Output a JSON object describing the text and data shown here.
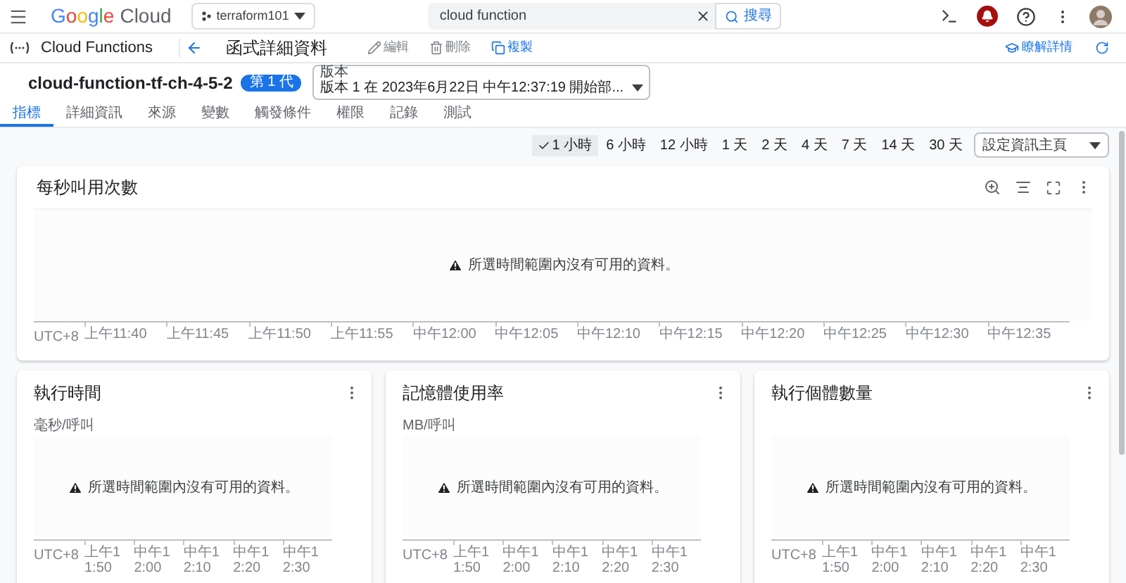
{
  "header": {
    "logo_word": "Google",
    "logo_product": "Cloud",
    "project": "terraform101",
    "search": {
      "value": "cloud function",
      "button": "搜尋"
    }
  },
  "subheader": {
    "product": "Cloud Functions",
    "page_title": "函式詳細資料",
    "actions": [
      {
        "label": "編輯",
        "disabled": true,
        "kind": "edit"
      },
      {
        "label": "刪除",
        "disabled": true,
        "kind": "delete"
      },
      {
        "label": "複製",
        "disabled": false,
        "kind": "copy"
      }
    ],
    "learn_more": "瞭解詳情"
  },
  "function": {
    "name": "cloud-function-tf-ch-4-5-2",
    "badge": "第 1 代",
    "version_label": "版本",
    "version": "版本 1 在 2023年6月22日 中午12:37:19 開始部..."
  },
  "tabs": [
    {
      "label": "指標",
      "selected": true
    },
    {
      "label": "詳細資訊",
      "selected": false
    },
    {
      "label": "來源",
      "selected": false
    },
    {
      "label": "變數",
      "selected": false
    },
    {
      "label": "觸發條件",
      "selected": false
    },
    {
      "label": "權限",
      "selected": false
    },
    {
      "label": "記錄",
      "selected": false
    },
    {
      "label": "測試",
      "selected": false
    }
  ],
  "time_ranges": [
    {
      "label": "1 小時",
      "selected": true
    },
    {
      "label": "6 小時",
      "selected": false
    },
    {
      "label": "12 小時",
      "selected": false
    },
    {
      "label": "1 天",
      "selected": false
    },
    {
      "label": "2 天",
      "selected": false
    },
    {
      "label": "4 天",
      "selected": false
    },
    {
      "label": "7 天",
      "selected": false
    },
    {
      "label": "14 天",
      "selected": false
    },
    {
      "label": "30 天",
      "selected": false
    }
  ],
  "dashboard_select": "設定資訊主頁",
  "main_chart": {
    "title": "每秒叫用次數",
    "message": "所選時間範圍內沒有可用的資料。",
    "timezone": "UTC+8",
    "ticks": [
      "上午11:40",
      "上午11:45",
      "上午11:50",
      "上午11:55",
      "中午12:00",
      "中午12:05",
      "中午12:10",
      "中午12:15",
      "中午12:20",
      "中午12:25",
      "中午12:30",
      "中午12:35"
    ]
  },
  "small_charts": [
    {
      "title": "執行時間",
      "subtitle": "毫秒/呼叫",
      "message": "所選時間範圍內沒有可用的資料。",
      "timezone": "UTC+8",
      "ticks": [
        "上午11:50",
        "中午12:00",
        "中午12:10",
        "中午12:20",
        "中午12:30"
      ]
    },
    {
      "title": "記憶體使用率",
      "subtitle": "MB/呼叫",
      "message": "所選時間範圍內沒有可用的資料。",
      "timezone": "UTC+8",
      "ticks": [
        "上午11:50",
        "中午12:00",
        "中午12:10",
        "中午12:20",
        "中午12:30"
      ]
    },
    {
      "title": "執行個體數量",
      "message": "所選時間範圍內沒有可用的資料。",
      "timezone": "UTC+8",
      "ticks": [
        "上午11:50",
        "中午12:00",
        "中午12:10",
        "中午12:20",
        "中午12:30"
      ]
    }
  ]
}
